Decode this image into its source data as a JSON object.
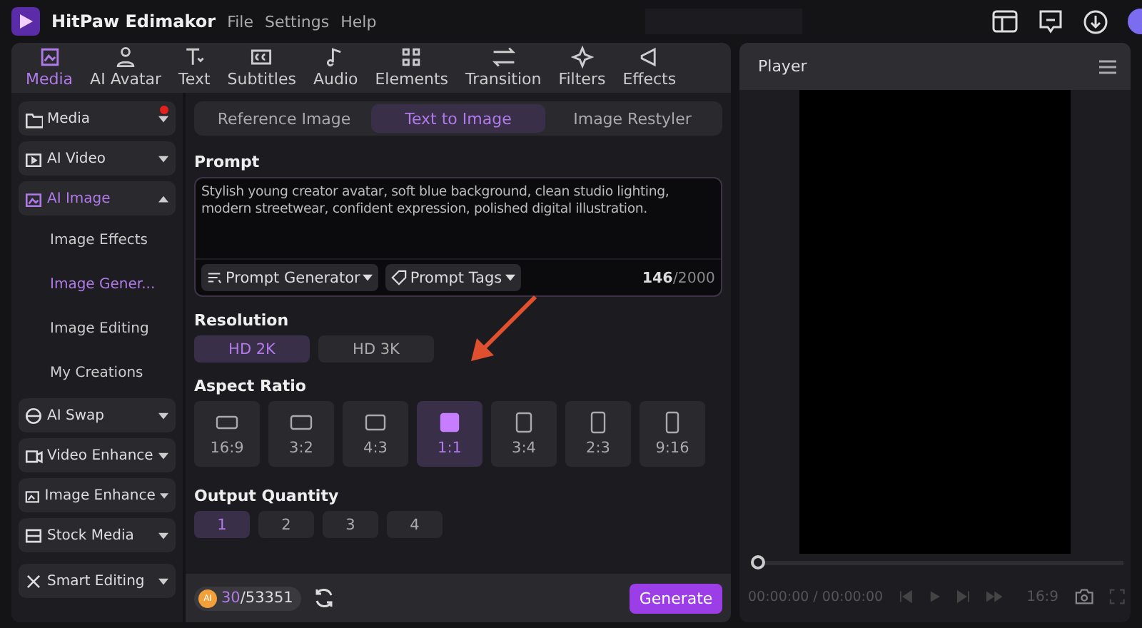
{
  "app": {
    "name": "HitPaw Edimakor",
    "menu": [
      "File",
      "Settings",
      "Help"
    ]
  },
  "toolbar": [
    {
      "label": "Media",
      "selected": true
    },
    {
      "label": "AI Avatar",
      "selected": false
    },
    {
      "label": "Text",
      "selected": false
    },
    {
      "label": "Subtitles",
      "selected": false
    },
    {
      "label": "Audio",
      "selected": false
    },
    {
      "label": "Elements",
      "selected": false
    },
    {
      "label": "Transition",
      "selected": false
    },
    {
      "label": "Filters",
      "selected": false
    },
    {
      "label": "Effects",
      "selected": false
    }
  ],
  "sidebar": [
    {
      "label": "Media",
      "expanded": false,
      "notification": true
    },
    {
      "label": "AI Video",
      "expanded": false,
      "notification": false
    },
    {
      "label": "AI Image",
      "expanded": true,
      "notification": false,
      "children": [
        {
          "label": "Image Effects",
          "selected": false
        },
        {
          "label": "Image Gener...",
          "selected": true
        },
        {
          "label": "Image Editing",
          "selected": false
        },
        {
          "label": "My Creations",
          "selected": false
        }
      ]
    },
    {
      "label": "AI Swap",
      "expanded": false,
      "notification": false
    },
    {
      "label": "Video Enhance",
      "expanded": false,
      "notification": false
    },
    {
      "label": "Image Enhance",
      "expanded": false,
      "notification": false
    },
    {
      "label": "Stock Media",
      "expanded": false,
      "notification": false
    },
    {
      "label": "Smart Editing",
      "expanded": false,
      "notification": false
    }
  ],
  "mode_tabs": [
    {
      "label": "Reference Image",
      "selected": false
    },
    {
      "label": "Text to Image",
      "selected": true
    },
    {
      "label": "Image Restyler",
      "selected": false
    }
  ],
  "prompt": {
    "title": "Prompt",
    "value": "Stylish young creator avatar, soft blue background, clean studio lighting, modern streetwear, confident expression, polished digital illustration.",
    "tools": [
      "Prompt Generator",
      "Prompt Tags"
    ],
    "count": "146",
    "limit": "/2000"
  },
  "resolution": {
    "title": "Resolution",
    "options": [
      {
        "label": "HD 2K",
        "selected": true
      },
      {
        "label": "HD 3K",
        "selected": false
      }
    ]
  },
  "aspect_ratio": {
    "title": "Aspect Ratio",
    "options": [
      {
        "label": "16:9",
        "selected": false
      },
      {
        "label": "3:2",
        "selected": false
      },
      {
        "label": "4:3",
        "selected": false
      },
      {
        "label": "1:1",
        "selected": true
      },
      {
        "label": "3:4",
        "selected": false
      },
      {
        "label": "2:3",
        "selected": false
      },
      {
        "label": "9:16",
        "selected": false
      }
    ]
  },
  "output_quantity": {
    "title": "Output Quantity",
    "options": [
      {
        "label": "1",
        "selected": true
      },
      {
        "label": "2",
        "selected": false
      },
      {
        "label": "3",
        "selected": false
      },
      {
        "label": "4",
        "selected": false
      }
    ]
  },
  "credits": {
    "badge": "AI",
    "used": "30",
    "total": "/53351"
  },
  "generate": "Generate",
  "player": {
    "title": "Player",
    "time": "00:00:00 / 00:00:00",
    "ratio": "16:9",
    "level": 0
  }
}
